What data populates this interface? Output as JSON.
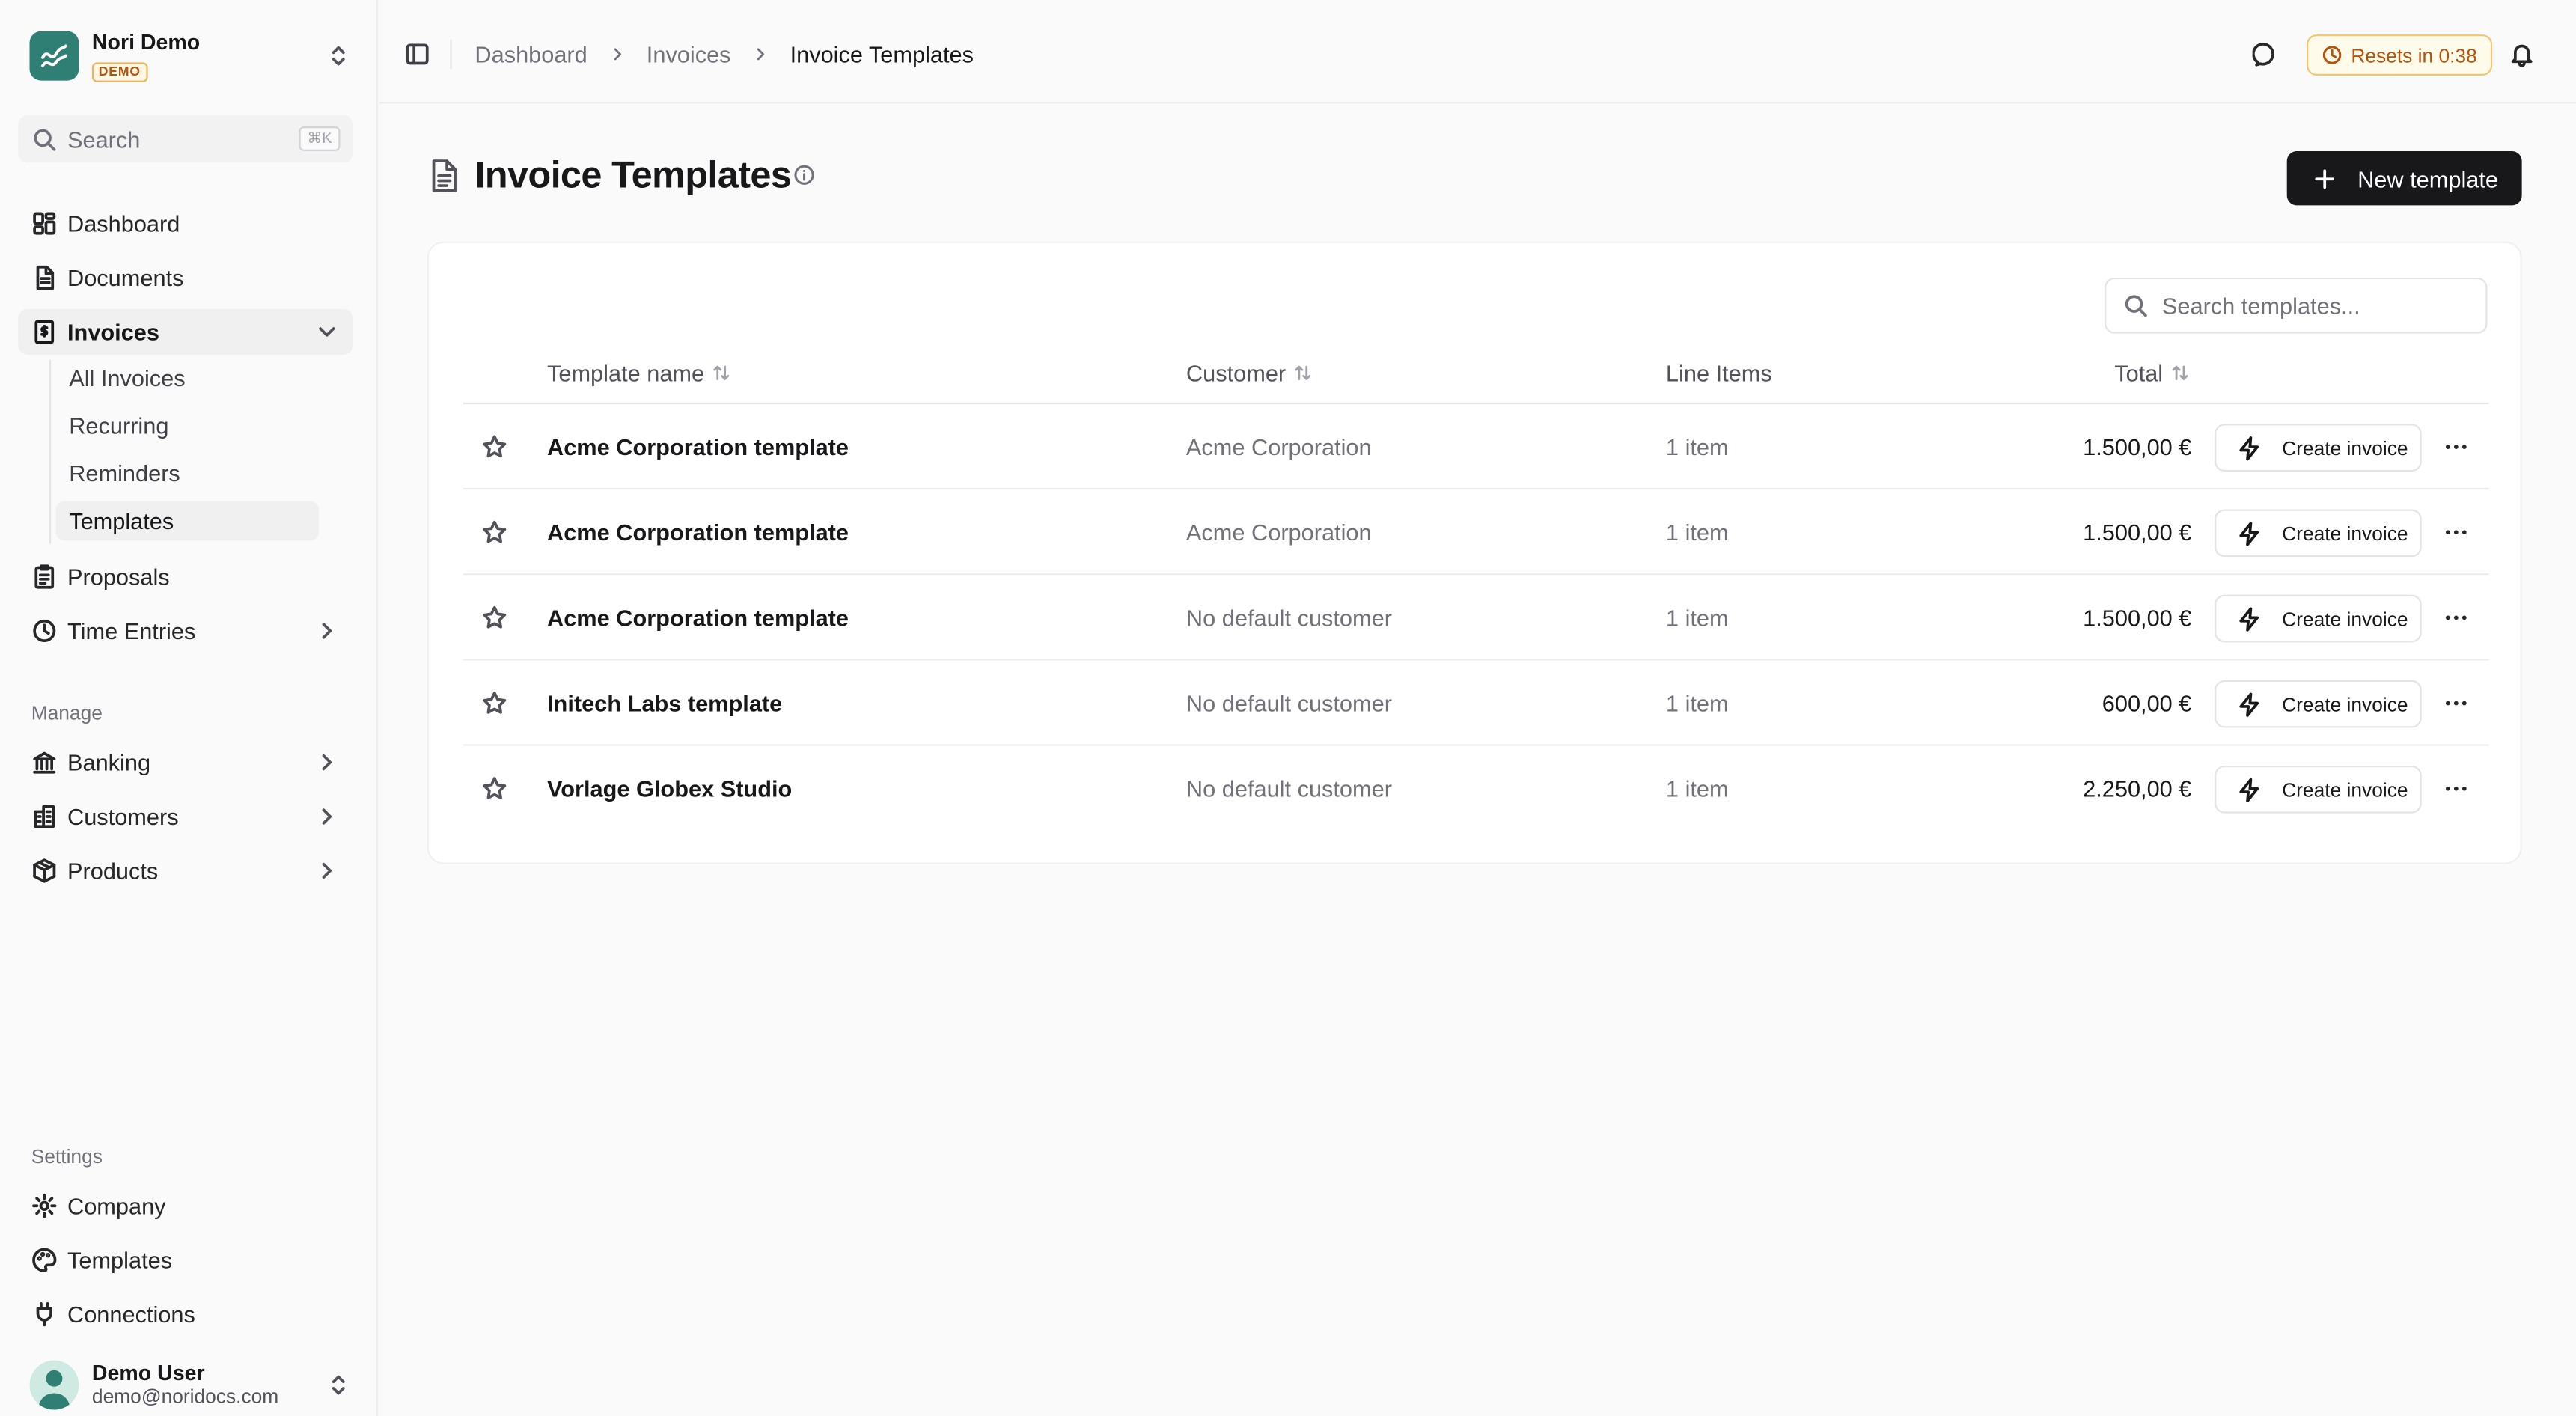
{
  "org": {
    "name": "Nori Demo",
    "badge": "DEMO"
  },
  "search": {
    "label": "Search",
    "shortcut": "⌘K"
  },
  "nav": {
    "main": [
      {
        "label": "Dashboard",
        "icon": "dashboard-icon"
      },
      {
        "label": "Documents",
        "icon": "document-icon"
      },
      {
        "label": "Invoices",
        "icon": "invoice-icon"
      },
      {
        "label": "Proposals",
        "icon": "clipboard-icon"
      },
      {
        "label": "Time Entries",
        "icon": "clock-icon"
      }
    ],
    "invoices_sub": [
      "All Invoices",
      "Recurring",
      "Reminders",
      "Templates"
    ],
    "manage_label": "Manage",
    "manage": [
      {
        "label": "Banking",
        "icon": "bank-icon"
      },
      {
        "label": "Customers",
        "icon": "building-icon"
      },
      {
        "label": "Products",
        "icon": "package-icon"
      }
    ],
    "settings_label": "Settings",
    "settings": [
      {
        "label": "Company",
        "icon": "gear-icon"
      },
      {
        "label": "Templates",
        "icon": "palette-icon"
      },
      {
        "label": "Connections",
        "icon": "plug-icon"
      }
    ]
  },
  "user": {
    "name": "Demo User",
    "email": "demo@noridocs.com"
  },
  "header": {
    "breadcrumb": [
      "Dashboard",
      "Invoices",
      "Invoice Templates"
    ],
    "resets": "Resets in 0:38"
  },
  "page": {
    "title": "Invoice Templates",
    "new_button": "New template",
    "search_placeholder": "Search templates..."
  },
  "table": {
    "columns": {
      "name": "Template name",
      "customer": "Customer",
      "line_items": "Line Items",
      "total": "Total"
    },
    "action_label": "Create invoice",
    "rows": [
      {
        "name": "Acme Corporation template",
        "customer": "Acme Corporation",
        "items": "1 item",
        "total": "1.500,00 €"
      },
      {
        "name": "Acme Corporation template",
        "customer": "Acme Corporation",
        "items": "1 item",
        "total": "1.500,00 €"
      },
      {
        "name": "Acme Corporation template",
        "customer": "No default customer",
        "items": "1 item",
        "total": "1.500,00 €"
      },
      {
        "name": "Initech Labs template",
        "customer": "No default customer",
        "items": "1 item",
        "total": "600,00 €"
      },
      {
        "name": "Vorlage Globex Studio",
        "customer": "No default customer",
        "items": "1 item",
        "total": "2.250,00 €"
      }
    ]
  },
  "colors": {
    "brand": "#2f7f74",
    "primary": "#18181b",
    "warning": "#b45309"
  }
}
